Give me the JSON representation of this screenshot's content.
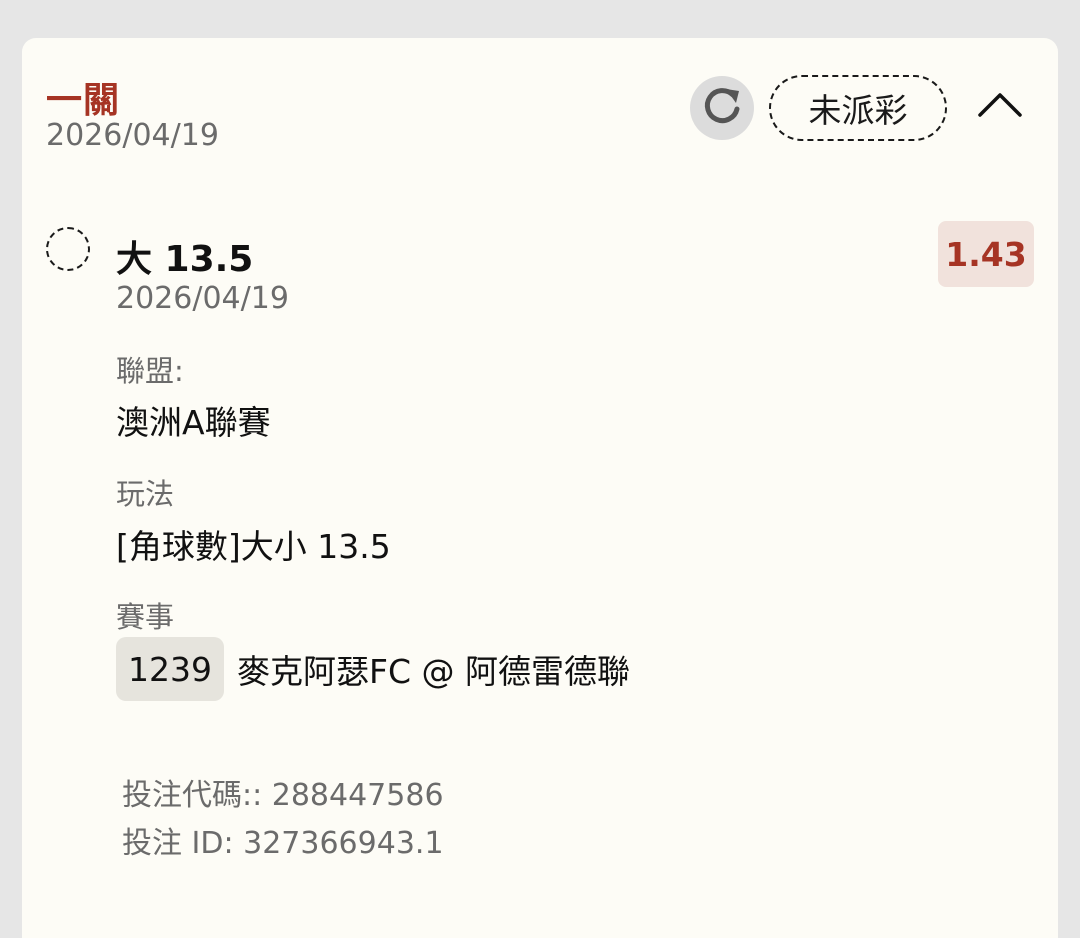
{
  "ticket": {
    "bet_type": "一關",
    "date": "2026/04/19",
    "status": "未派彩"
  },
  "leg": {
    "selection": "大 13.5",
    "date": "2026/04/19",
    "odds": "1.43",
    "league_label": "聯盟:",
    "league_value": "澳洲A聯賽",
    "market_label": "玩法",
    "market_value": "[角球數]大小 13.5",
    "match_label": "賽事",
    "match_code": "1239",
    "match_teams": "麥克阿瑟FC @ 阿德雷德聯"
  },
  "refs": {
    "bet_code": "投注代碼:: 288447586",
    "bet_id": "投注 ID: 327366943.1"
  },
  "icons": {
    "refresh": "refresh-icon",
    "collapse": "chevron-up-icon",
    "status_circle": "dashed-circle-icon"
  },
  "colors": {
    "accent": "#a63424",
    "odds_bg": "#f1e2dc",
    "card_bg": "#fdfcf6",
    "page_bg": "#e6e6e6"
  }
}
